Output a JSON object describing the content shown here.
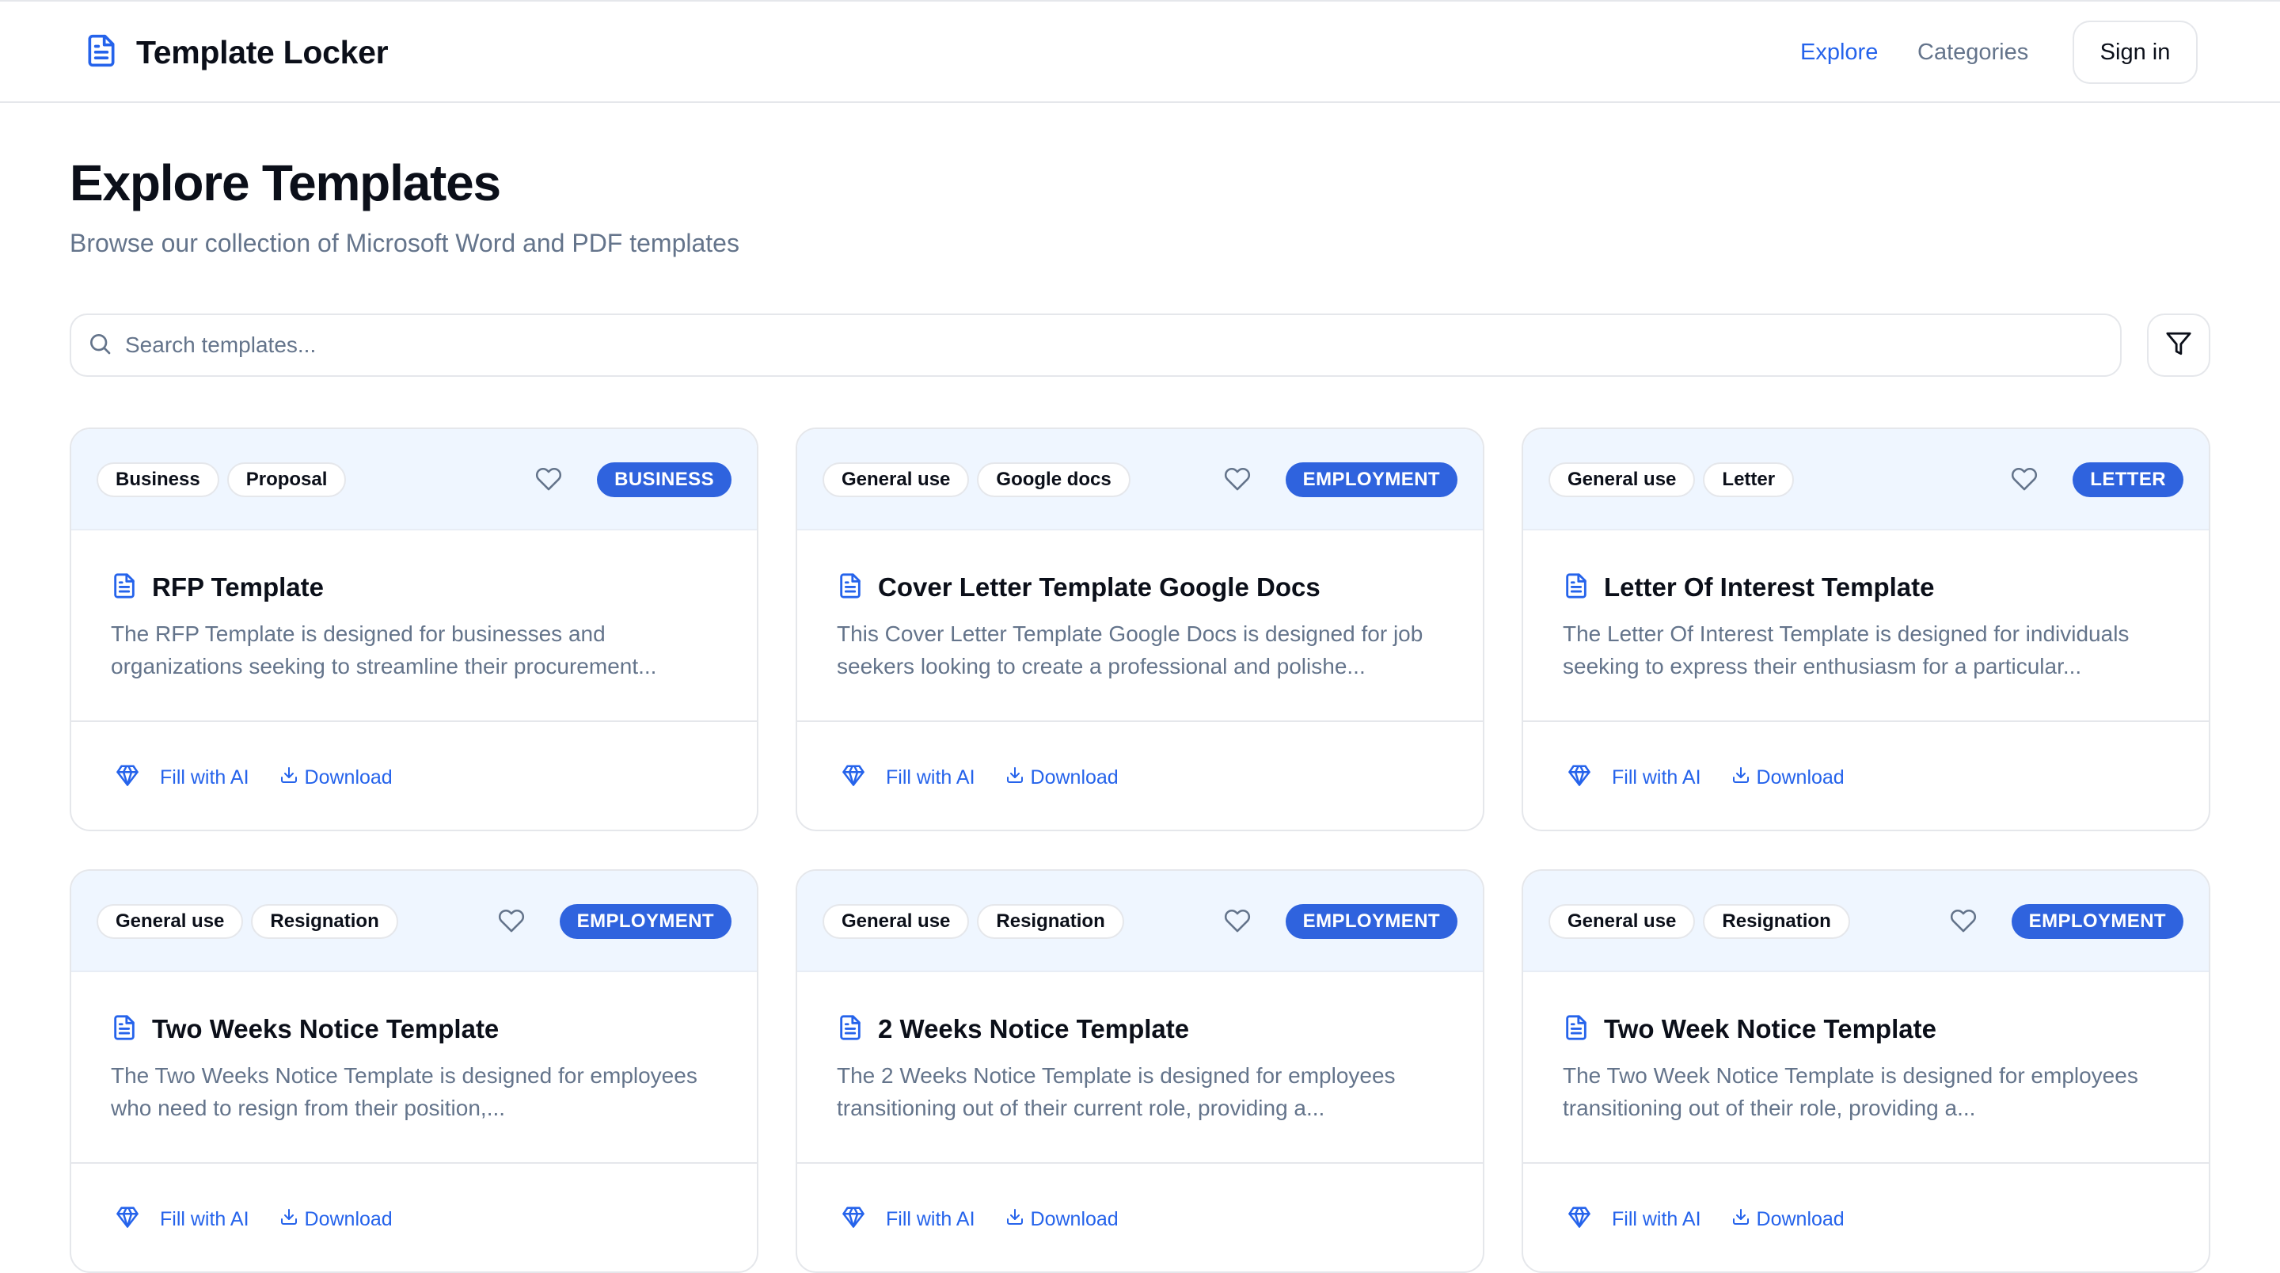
{
  "header": {
    "brand": "Template Locker",
    "nav": {
      "explore": "Explore",
      "categories": "Categories"
    },
    "sign_in": "Sign in"
  },
  "page": {
    "title": "Explore Templates",
    "subtitle": "Browse our collection of Microsoft Word and PDF templates"
  },
  "search": {
    "placeholder": "Search templates...",
    "value": ""
  },
  "colors": {
    "accent": "#2563eb",
    "badge": "#2f63de",
    "card_header_bg": "#eff6ff",
    "muted_text": "#64748b"
  },
  "icons": {
    "brand": "document-icon",
    "search": "search-icon",
    "filter": "filter-icon",
    "favorite": "heart-icon",
    "template": "document-icon",
    "fill_ai": "diamond-icon",
    "download": "download-icon"
  },
  "cards": [
    {
      "tags": [
        "Business",
        "Proposal"
      ],
      "badge": "BUSINESS",
      "title": "RFP Template",
      "description": "The RFP Template is designed for businesses and organizations seeking to streamline their procurement...",
      "fill_label": "Fill with AI",
      "download_label": "Download"
    },
    {
      "tags": [
        "General use",
        "Google docs"
      ],
      "badge": "EMPLOYMENT",
      "title": "Cover Letter Template Google Docs",
      "description": "This Cover Letter Template Google Docs is designed for job seekers looking to create a professional and polishe...",
      "fill_label": "Fill with AI",
      "download_label": "Download"
    },
    {
      "tags": [
        "General use",
        "Letter"
      ],
      "badge": "LETTER",
      "title": "Letter Of Interest Template",
      "description": "The Letter Of Interest Template is designed for individuals seeking to express their enthusiasm for a particular...",
      "fill_label": "Fill with AI",
      "download_label": "Download"
    },
    {
      "tags": [
        "General use",
        "Resignation"
      ],
      "badge": "EMPLOYMENT",
      "title": "Two Weeks Notice Template",
      "description": "The Two Weeks Notice Template is designed for employees who need to resign from their position,...",
      "fill_label": "Fill with AI",
      "download_label": "Download"
    },
    {
      "tags": [
        "General use",
        "Resignation"
      ],
      "badge": "EMPLOYMENT",
      "title": "2 Weeks Notice Template",
      "description": "The 2 Weeks Notice Template is designed for employees transitioning out of their current role, providing a...",
      "fill_label": "Fill with AI",
      "download_label": "Download"
    },
    {
      "tags": [
        "General use",
        "Resignation"
      ],
      "badge": "EMPLOYMENT",
      "title": "Two Week Notice Template",
      "description": "The Two Week Notice Template is designed for employees transitioning out of their role, providing a...",
      "fill_label": "Fill with AI",
      "download_label": "Download"
    }
  ]
}
